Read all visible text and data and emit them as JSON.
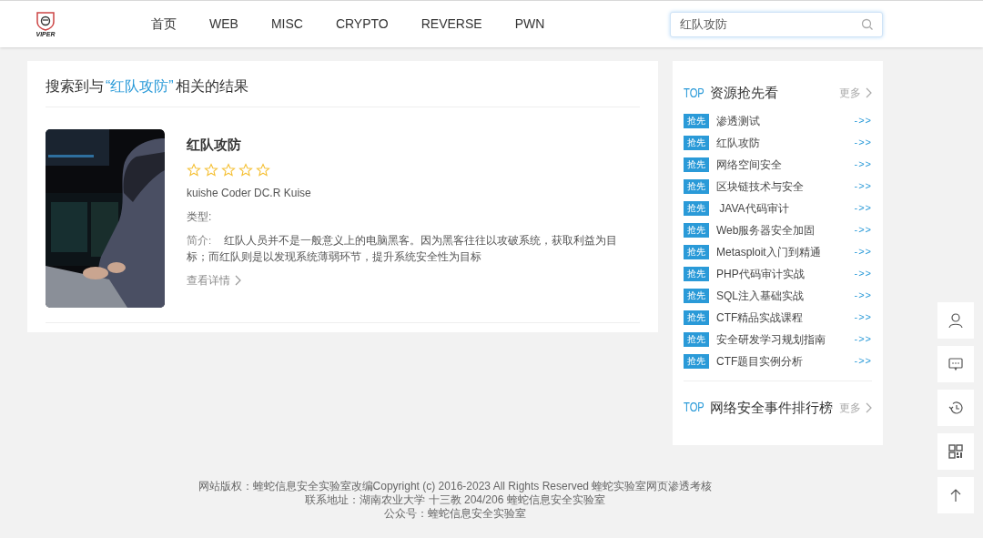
{
  "header": {
    "logo_text": "VIPER",
    "nav": [
      {
        "label": "首页"
      },
      {
        "label": "WEB"
      },
      {
        "label": "MISC"
      },
      {
        "label": "CRYPTO"
      },
      {
        "label": "REVERSE"
      },
      {
        "label": "PWN"
      }
    ],
    "search": {
      "value": "红队攻防"
    }
  },
  "results": {
    "heading": {
      "prefix": "搜索到与",
      "query": "“红队攻防”",
      "suffix": "相关的结果"
    },
    "items": [
      {
        "kind": "picture",
        "title": "红队攻防",
        "stars": 0,
        "author": "kuishe Coder DC.R Kuise",
        "type_label": "类型:",
        "intro_label": "简介:",
        "intro": "红队人员并不是一般意义上的电脑黑客。因为黑客往往以攻破系统，获取利益为目标；而红队则是以发现系统薄弱环节，提升系统安全性为目标",
        "details": "查看详情"
      }
    ]
  },
  "sidebar": {
    "sections": [
      {
        "top": "TOP",
        "title": "资源抢先看",
        "more": "更多",
        "items": [
          {
            "tag": "抢先",
            "label": "渗透测试",
            "arrow": "->>"
          },
          {
            "tag": "抢先",
            "label": "红队攻防",
            "arrow": "->>"
          },
          {
            "tag": "抢先",
            "label": "网络空间安全",
            "arrow": "->>"
          },
          {
            "tag": "抢先",
            "label": "区块链技术与安全",
            "arrow": "->>"
          },
          {
            "tag": "抢先",
            "label": " JAVA代码审计",
            "arrow": "->>"
          },
          {
            "tag": "抢先",
            "label": "Web服务器安全加固",
            "arrow": "->>"
          },
          {
            "tag": "抢先",
            "label": "Metasploit入门到精通",
            "arrow": "->>"
          },
          {
            "tag": "抢先",
            "label": "PHP代码审计实战",
            "arrow": "->>"
          },
          {
            "tag": "抢先",
            "label": "SQL注入基础实战",
            "arrow": "->>"
          },
          {
            "tag": "抢先",
            "label": "CTF精品实战课程",
            "arrow": "->>"
          },
          {
            "tag": "抢先",
            "label": "安全研发学习规划指南",
            "arrow": "->>"
          },
          {
            "tag": "抢先",
            "label": "CTF题目实例分析",
            "arrow": "->>"
          }
        ]
      },
      {
        "top": "TOP",
        "title": "网络安全事件排行榜",
        "more": "更多"
      }
    ]
  },
  "float_buttons": [
    {
      "kind": "user"
    },
    {
      "kind": "chat"
    },
    {
      "kind": "history"
    },
    {
      "kind": "qr"
    },
    {
      "kind": "top"
    }
  ],
  "footer": [
    "网站版权：蝰蛇信息安全实验室改编Copyright (c) 2016-2023 All Rights Reserved 蝰蛇实验室网页渗透考核",
    "联系地址：湖南农业大学 十三教 204/206 蝰蛇信息安全实验室",
    "公众号：蝰蛇信息安全实验室"
  ]
}
